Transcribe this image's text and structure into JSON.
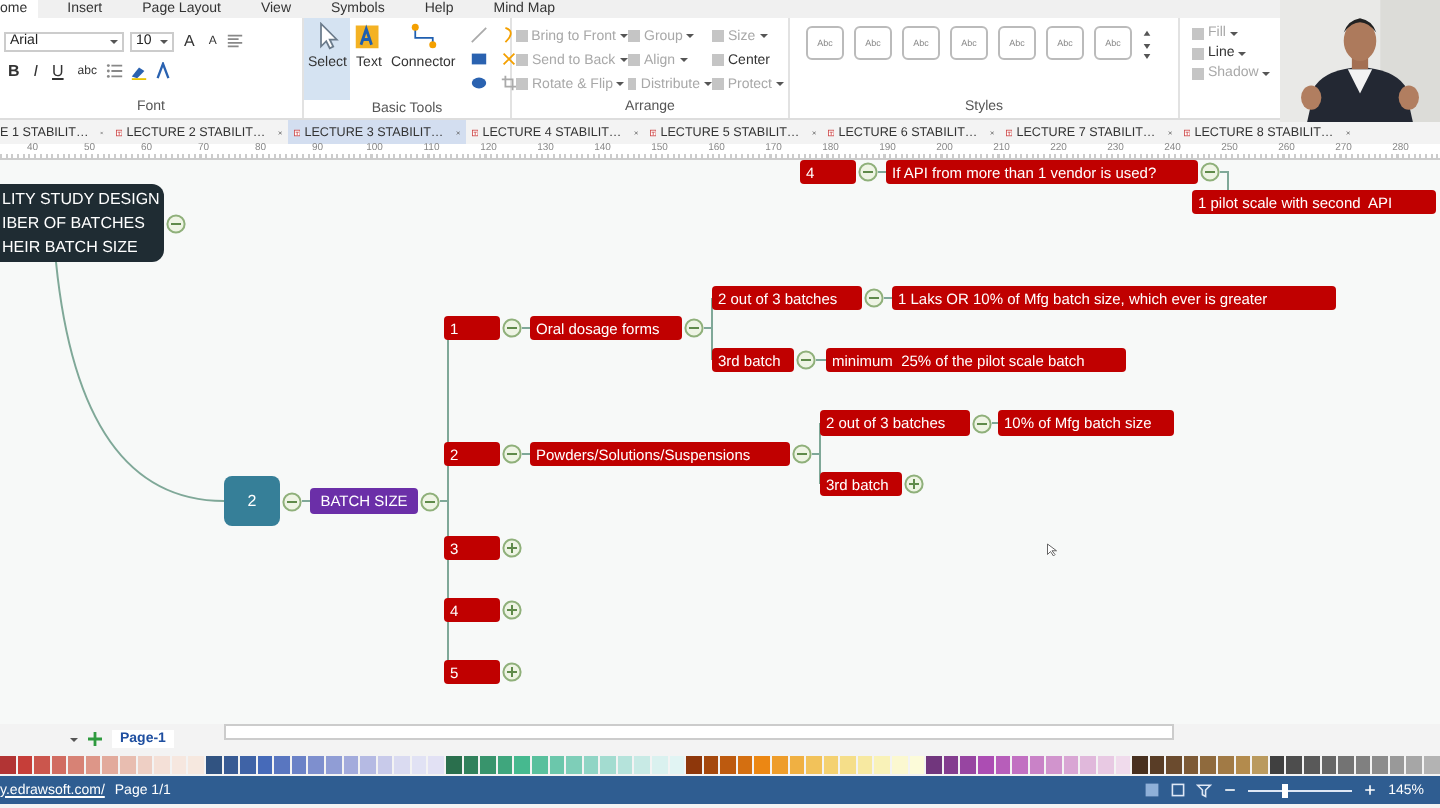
{
  "menu": [
    {
      "label": "ome",
      "selected": true
    },
    {
      "label": "Insert",
      "selected": false
    },
    {
      "label": "Page Layout",
      "selected": false
    },
    {
      "label": "View",
      "selected": false
    },
    {
      "label": "Symbols",
      "selected": false
    },
    {
      "label": "Help",
      "selected": false
    },
    {
      "label": "Mind Map",
      "selected": false
    }
  ],
  "ribbon": {
    "font": {
      "name": "Arial",
      "size": "10",
      "size_buttons": [
        "A",
        "A"
      ],
      "style_buttons": [
        "B",
        "I",
        "U",
        "abc"
      ],
      "label": "Font"
    },
    "basic_tools": {
      "tools": [
        {
          "label": "Select",
          "selected": true
        },
        {
          "label": "Text",
          "selected": false
        },
        {
          "label": "Connector",
          "selected": false
        }
      ],
      "label": "Basic Tools"
    },
    "arrange": {
      "items": [
        {
          "label": "Bring to Front",
          "disabled": true,
          "dropdown": true
        },
        {
          "label": "Send to Back",
          "disabled": true,
          "dropdown": true
        },
        {
          "label": "Rotate & Flip",
          "disabled": true,
          "dropdown": true
        },
        {
          "label": "Group",
          "disabled": true,
          "dropdown": true
        },
        {
          "label": "Align",
          "disabled": true,
          "dropdown": true
        },
        {
          "label": "Distribute",
          "disabled": true,
          "dropdown": true
        },
        {
          "label": "Size",
          "disabled": true,
          "dropdown": true
        },
        {
          "label": "Center",
          "disabled": false,
          "dropdown": false
        },
        {
          "label": "Protect",
          "disabled": true,
          "dropdown": true
        }
      ],
      "label": "Arrange"
    },
    "styles": {
      "swatches": [
        "Abc",
        "Abc",
        "Abc",
        "Abc",
        "Abc",
        "Abc",
        "Abc"
      ],
      "label": "Styles"
    },
    "format": [
      {
        "label": "Fill",
        "disabled": true
      },
      {
        "label": "Line",
        "disabled": false
      },
      {
        "label": "Shadow",
        "disabled": true
      }
    ]
  },
  "tabs": [
    {
      "label": "E 1 STABILIT…",
      "selected": false
    },
    {
      "label": "LECTURE 2 STABILIT…",
      "selected": false
    },
    {
      "label": "LECTURE 3 STABILIT…",
      "selected": true
    },
    {
      "label": "LECTURE 4 STABILIT…",
      "selected": false
    },
    {
      "label": "LECTURE 5 STABILIT…",
      "selected": false
    },
    {
      "label": "LECTURE 6 STABILIT…",
      "selected": false
    },
    {
      "label": "LECTURE 7 STABILIT…",
      "selected": false
    },
    {
      "label": "LECTURE 8 STABILIT…",
      "selected": false
    }
  ],
  "ruler_labels": [
    "40",
    "50",
    "60",
    "70",
    "80",
    "90",
    "100",
    "110",
    "120",
    "130",
    "140",
    "150",
    "160",
    "170",
    "180",
    "190",
    "200",
    "210",
    "220",
    "230",
    "240",
    "250",
    "260",
    "270",
    "280"
  ],
  "mind_map": {
    "trees": [
      {
        "kind": "central",
        "text": "LITY STUDY DESIGN\nIBER OF BATCHES\nHEIR BATCH SIZE",
        "collapsed": false,
        "children": [
          {
            "kind": "number",
            "text": "2",
            "collapsed": false,
            "children": [
              {
                "kind": "label",
                "text": "BATCH SIZE",
                "collapsed": false,
                "children": [
                  {
                    "kind": "topic",
                    "text": "1",
                    "collapsed": false,
                    "children": [
                      {
                        "kind": "topic",
                        "text": "Oral dosage forms",
                        "collapsed": false,
                        "children": [
                          {
                            "kind": "topic",
                            "text": "2 out of 3 batches",
                            "collapsed": false,
                            "children": [
                              {
                                "kind": "topic",
                                "text": "1 Laks OR 10% of Mfg batch size, which ever is greater"
                              }
                            ]
                          },
                          {
                            "kind": "topic",
                            "text": "3rd batch",
                            "collapsed": false,
                            "children": [
                              {
                                "kind": "topic",
                                "text": "minimum  25% of the pilot scale batch"
                              }
                            ]
                          }
                        ]
                      }
                    ]
                  },
                  {
                    "kind": "topic",
                    "text": "2",
                    "collapsed": false,
                    "children": [
                      {
                        "kind": "topic",
                        "text": "Powders/Solutions/Suspensions",
                        "collapsed": false,
                        "children": [
                          {
                            "kind": "topic",
                            "text": "2 out of 3 batches",
                            "collapsed": false,
                            "children": [
                              {
                                "kind": "topic",
                                "text": "10% of Mfg batch size"
                              }
                            ]
                          },
                          {
                            "kind": "topic",
                            "text": "3rd batch",
                            "collapsed": true
                          }
                        ]
                      }
                    ]
                  },
                  {
                    "kind": "topic",
                    "text": "3",
                    "collapsed": true
                  },
                  {
                    "kind": "topic",
                    "text": "4",
                    "collapsed": true
                  },
                  {
                    "kind": "topic",
                    "text": "5",
                    "collapsed": true
                  }
                ]
              }
            ]
          }
        ]
      },
      {
        "kind": "topic",
        "text": "4",
        "collapsed": false,
        "children": [
          {
            "kind": "topic",
            "text": "If API from more than 1 vendor is used?",
            "collapsed": false,
            "children": [
              {
                "kind": "topic",
                "text": "1 pilot scale with second  API"
              }
            ]
          }
        ]
      }
    ]
  },
  "page_bar": {
    "page": "Page-1"
  },
  "status_bar": {
    "link": "y.edrawsoft.com/",
    "page": "Page 1/1",
    "zoom": {
      "level": 0.35,
      "reading": "145%"
    }
  }
}
